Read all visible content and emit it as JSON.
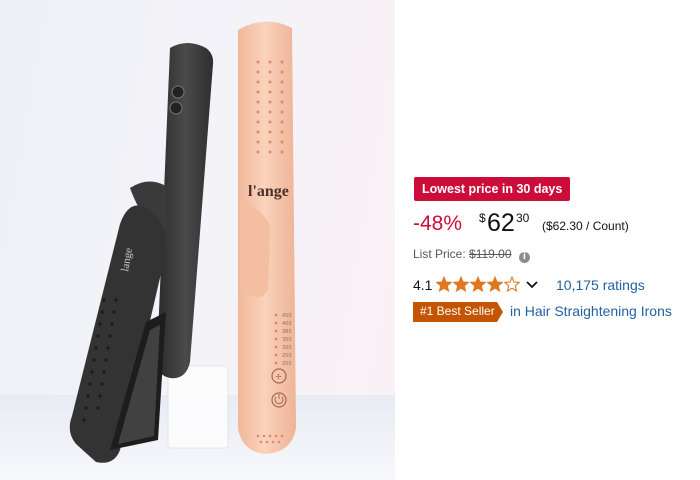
{
  "product_image": {
    "brand_mark": "l'ange",
    "dark_iron_label": "lange",
    "temperature_marks": [
      "450",
      "400",
      "380",
      "350",
      "300",
      "250",
      "200"
    ]
  },
  "deal": {
    "badge": "Lowest price in 30 days"
  },
  "price": {
    "discount": "-48%",
    "symbol": "$",
    "whole": "62",
    "fraction": "30",
    "unit_price": "($62.30 / Count)"
  },
  "list_price": {
    "label": "List Price:",
    "value": "$119.00"
  },
  "rating": {
    "value": "4.1",
    "stars_filled": 4.1,
    "stars_max": 5,
    "ratings_count": "10,175 ratings"
  },
  "best_seller": {
    "badge": "#1 Best Seller",
    "category": "in Hair Straightening Irons"
  },
  "colors": {
    "deal_red": "#cc0c39",
    "star_orange": "#de7921",
    "link_blue": "#2162a1",
    "best_seller_orange": "#c45500"
  },
  "icons": [
    "info-icon",
    "star-icon",
    "chevron-down-icon"
  ]
}
